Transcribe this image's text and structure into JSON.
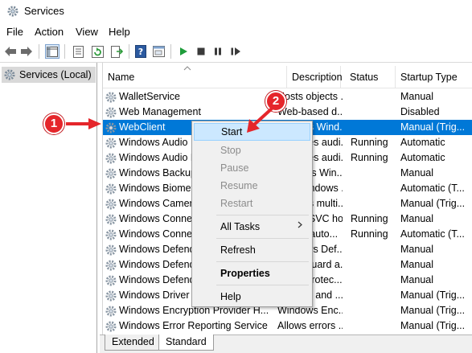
{
  "window": {
    "title": "Services"
  },
  "menu": [
    "File",
    "Action",
    "View",
    "Help"
  ],
  "tree": {
    "selected_label": "Services (Local)"
  },
  "columns": {
    "name": "Name",
    "description": "Description",
    "status": "Status",
    "startup": "Startup Type"
  },
  "services": [
    {
      "name": "WalletService",
      "description": "Hosts objects ...",
      "status": "",
      "startup": "Manual"
    },
    {
      "name": "Web Management",
      "description": "Web-based d...",
      "status": "",
      "startup": "Disabled"
    },
    {
      "name": "WebClient",
      "description": "Enables Wind...",
      "status": "",
      "startup": "Manual (Trig..."
    },
    {
      "name": "Windows Audio",
      "description": "Manages audi...",
      "status": "Running",
      "startup": "Automatic"
    },
    {
      "name": "Windows Audio Endpoint Builder",
      "description": "Manages audi...",
      "status": "Running",
      "startup": "Automatic"
    },
    {
      "name": "Windows Backup",
      "description": "Provides Win...",
      "status": "",
      "startup": "Manual"
    },
    {
      "name": "Windows Biometric Service",
      "description": "The Windows ...",
      "status": "",
      "startup": "Automatic (T..."
    },
    {
      "name": "Windows Camera Frame Server",
      "description": "Enables multi...",
      "status": "",
      "startup": "Manual (Trig..."
    },
    {
      "name": "Windows Connect Now",
      "description": "WCNCSVC ho...",
      "status": "Running",
      "startup": "Manual"
    },
    {
      "name": "Windows Connection Manager",
      "description": "Makes auto...",
      "status": "Running",
      "startup": "Automatic (T..."
    },
    {
      "name": "Windows Defender Advanced",
      "description": "Windows Def...",
      "status": "",
      "startup": "Manual"
    },
    {
      "name": "Windows Defender Antivirus",
      "description": "Helps guard a...",
      "status": "",
      "startup": "Manual"
    },
    {
      "name": "Windows Defender Firewall",
      "description": "Helps protec...",
      "status": "",
      "startup": "Manual"
    },
    {
      "name": "Windows Driver Foundation",
      "description": "Creates and ...",
      "status": "",
      "startup": "Manual (Trig..."
    },
    {
      "name": "Windows Encryption Provider H...",
      "description": "Windows Enc...",
      "status": "",
      "startup": "Manual (Trig..."
    },
    {
      "name": "Windows Error Reporting Service",
      "description": "Allows errors ...",
      "status": "",
      "startup": "Manual (Trig..."
    }
  ],
  "tabs": {
    "extended": "Extended",
    "standard": "Standard"
  },
  "context_menu": {
    "start": "Start",
    "stop": "Stop",
    "pause": "Pause",
    "resume": "Resume",
    "restart": "Restart",
    "all_tasks": "All Tasks",
    "refresh": "Refresh",
    "properties": "Properties",
    "help": "Help"
  },
  "annotations": {
    "badge1": "1",
    "badge2": "2"
  },
  "colors": {
    "selection": "#0078d7",
    "menu_hover": "#cce8ff",
    "annotation_red": "#e5262b"
  }
}
